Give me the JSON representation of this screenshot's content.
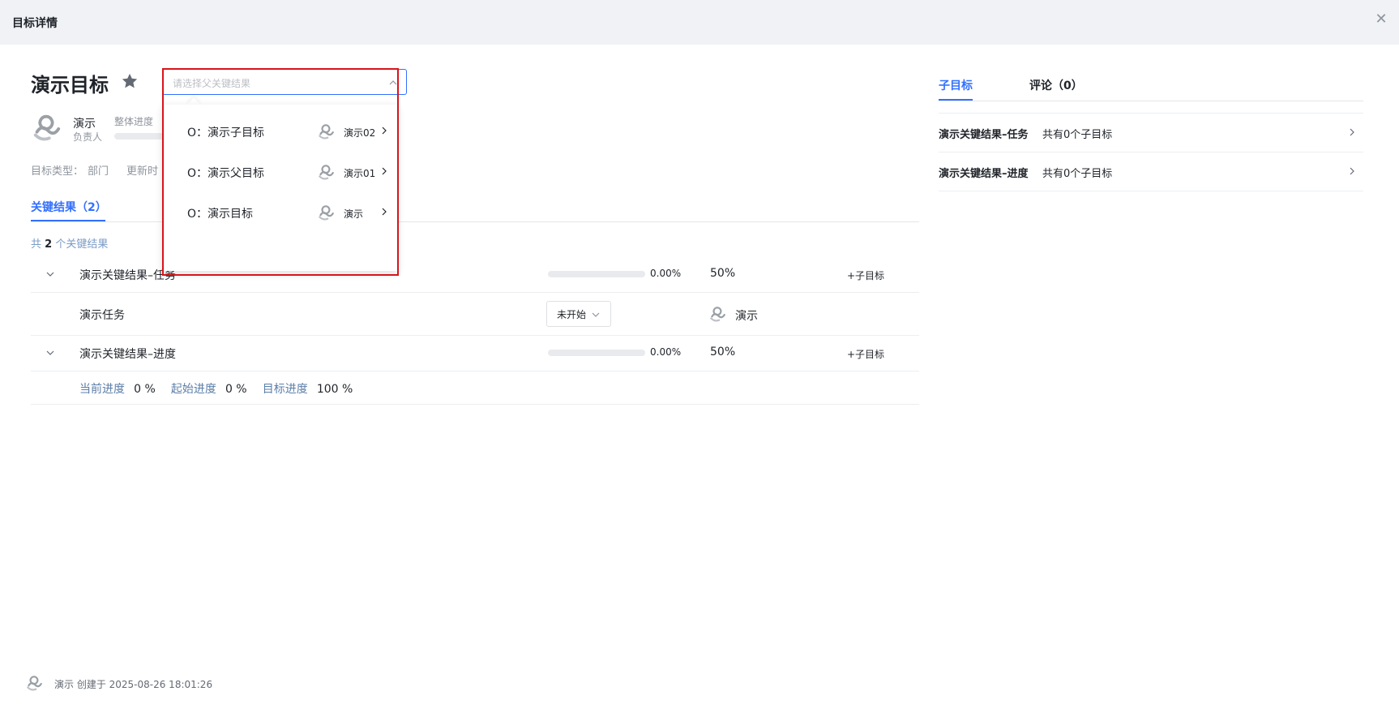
{
  "window": {
    "title": "目标详情"
  },
  "goal": {
    "title": "演示目标",
    "parent_select_placeholder": "请选择父关键结果",
    "owner": {
      "name": "演示",
      "role": "负责人"
    },
    "progress_label": "整体进度",
    "type_label": "目标类型：",
    "type_value": "部门",
    "updated_label": "更新时"
  },
  "key_results_tab": {
    "label": "关键结果（2）"
  },
  "kr_count": {
    "prefix": "共",
    "count": "2",
    "suffix": "个关键结果"
  },
  "key_results": [
    {
      "name": "演示关键结果–任务",
      "progress": "0.00%",
      "weight": "50%",
      "add_child": "+子目标"
    },
    {
      "name": "演示关键结果–进度",
      "progress": "0.00%",
      "weight": "50%",
      "add_child": "+子目标"
    }
  ],
  "task": {
    "name": "演示任务",
    "status": "未开始",
    "assignee": "演示"
  },
  "progress_detail": {
    "current_label": "当前进度",
    "current_value": "0 %",
    "start_label": "起始进度",
    "start_value": "0 %",
    "target_label": "目标进度",
    "target_value": "100 %"
  },
  "dropdown": {
    "items": [
      {
        "label": "O：演示子目标",
        "owner": "演示02"
      },
      {
        "label": "O：演示父目标",
        "owner": "演示01"
      },
      {
        "label": "O：演示目标",
        "owner": "演示"
      }
    ]
  },
  "right_panel": {
    "tabs": [
      {
        "label": "子目标"
      },
      {
        "label": "评论（0）"
      }
    ],
    "rows": [
      {
        "name": "演示关键结果–任务",
        "count": "共有0个子目标"
      },
      {
        "name": "演示关键结果–进度",
        "count": "共有0个子目标"
      }
    ]
  },
  "footer": {
    "text": "演示 创建于 2025-08-26 18:01:26"
  },
  "colors": {
    "accent": "#3370ff",
    "highlight": "#d9141a"
  }
}
